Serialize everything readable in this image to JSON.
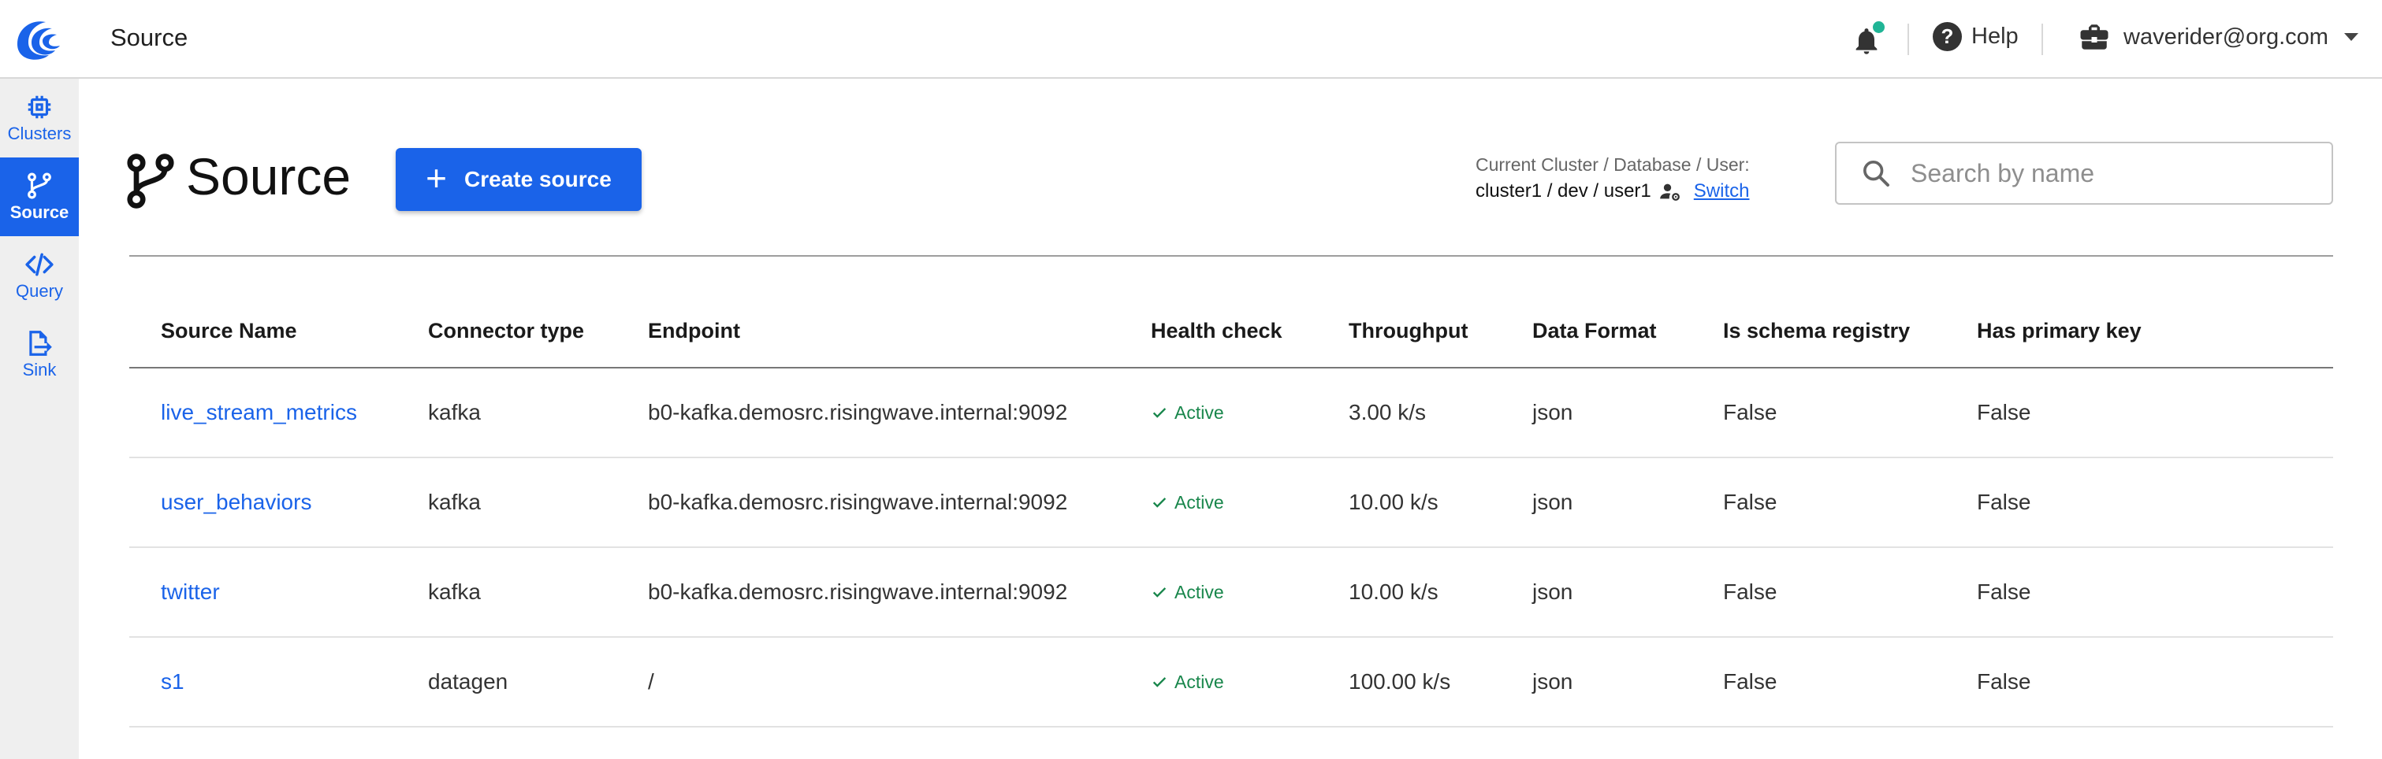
{
  "header": {
    "title": "Source",
    "help_label": "Help",
    "user_email": "waverider@org.com"
  },
  "sidebar": {
    "items": [
      {
        "label": "Clusters",
        "icon": "chip-icon"
      },
      {
        "label": "Source",
        "icon": "branch-icon"
      },
      {
        "label": "Query",
        "icon": "code-icon"
      },
      {
        "label": "Sink",
        "icon": "file-export-icon"
      }
    ]
  },
  "page": {
    "title": "Source",
    "create_button": "Create source",
    "context_label": "Current Cluster / Database / User:",
    "context_value": "cluster1 / dev / user1",
    "switch_label": "Switch",
    "search_placeholder": "Search by name"
  },
  "table": {
    "columns": [
      "Source Name",
      "Connector type",
      "Endpoint",
      "Health check",
      "Throughput",
      "Data Format",
      "Is schema registry",
      "Has primary key"
    ],
    "rows": [
      {
        "name": "live_stream_metrics",
        "connector": "kafka",
        "endpoint": "b0-kafka.demosrc.risingwave.internal:9092",
        "health": "Active",
        "throughput": "3.00 k/s",
        "format": "json",
        "schema_registry": "False",
        "primary_key": "False"
      },
      {
        "name": "user_behaviors",
        "connector": "kafka",
        "endpoint": "b0-kafka.demosrc.risingwave.internal:9092",
        "health": "Active",
        "throughput": "10.00 k/s",
        "format": "json",
        "schema_registry": "False",
        "primary_key": "False"
      },
      {
        "name": "twitter",
        "connector": "kafka",
        "endpoint": "b0-kafka.demosrc.risingwave.internal:9092",
        "health": "Active",
        "throughput": "10.00 k/s",
        "format": "json",
        "schema_registry": "False",
        "primary_key": "False"
      },
      {
        "name": "s1",
        "connector": "datagen",
        "endpoint": "/",
        "health": "Active",
        "throughput": "100.00 k/s",
        "format": "json",
        "schema_registry": "False",
        "primary_key": "False"
      }
    ]
  },
  "colors": {
    "accent": "#1a63e9",
    "health_active": "#18864b",
    "notification_dot": "#20b596",
    "sidebar_bg": "#efefef"
  }
}
